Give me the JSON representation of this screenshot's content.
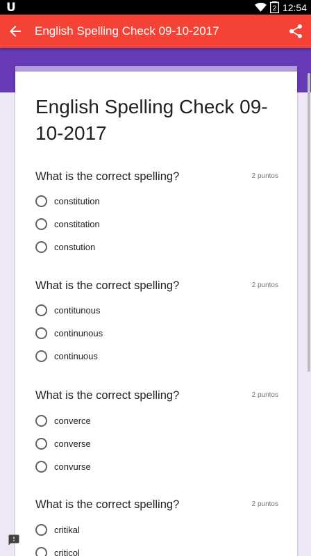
{
  "status_bar": {
    "notification_glyph": "U",
    "battery_level": "2",
    "time": "12:54"
  },
  "app_bar": {
    "title": "English Spelling Check 09-10-2017",
    "back_icon": "arrow-back-icon",
    "share_icon": "share-icon"
  },
  "form": {
    "title": "English Spelling Check 09-10-2017",
    "questions": [
      {
        "title": "What is the correct spelling?",
        "points": "2 puntos",
        "options": [
          "constitution",
          "constitation",
          "constution"
        ]
      },
      {
        "title": "What is the correct spelling?",
        "points": "2 puntos",
        "options": [
          "contitunous",
          "continunous",
          "continuous"
        ]
      },
      {
        "title": "What is the correct spelling?",
        "points": "2 puntos",
        "options": [
          "converce",
          "converse",
          "convurse"
        ]
      },
      {
        "title": "What is the correct spelling?",
        "points": "2 puntos",
        "options": [
          "critikal",
          "criticol"
        ]
      }
    ]
  },
  "feedback_icon": "report-feedback-icon",
  "colors": {
    "app_bar": "#f44336",
    "header": "#673ab7",
    "card_accent": "#b39ddb",
    "background": "#ede7f6"
  }
}
